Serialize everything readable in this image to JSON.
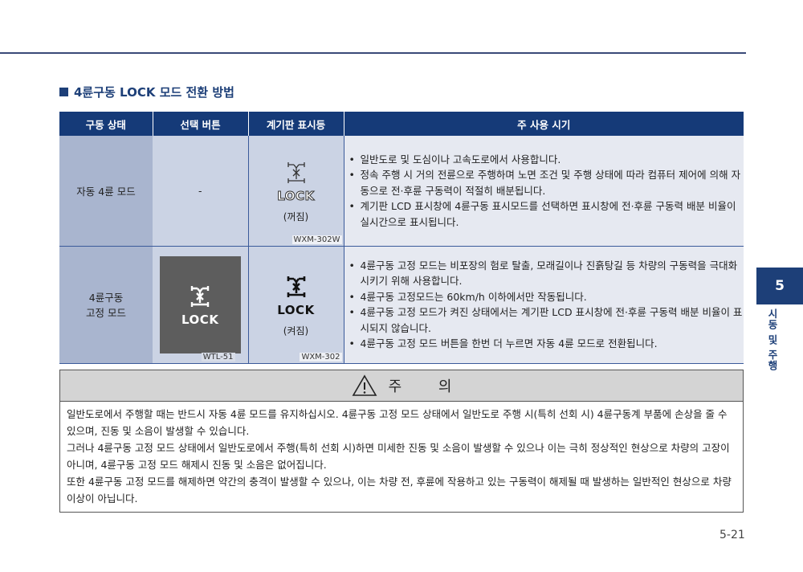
{
  "section": {
    "title": "4륜구동 LOCK 모드 전환 방법"
  },
  "table": {
    "headers": [
      "구동 상태",
      "선택 버튼",
      "계기판 표시등",
      "주 사용 시기"
    ],
    "rows": [
      {
        "state": "자동 4륜 모드",
        "button": "-",
        "indicator_label": "LOCK",
        "indicator_state": "(꺼짐)",
        "indicator_code": "WXM-302W",
        "uses": [
          "일반도로 및 도심이나 고속도로에서 사용합니다.",
          "정속 주행 시 거의 전륜으로 주행하며 노면 조건 및 주행 상태에 따라 컴퓨터 제어에 의해 자동으로 전·후륜 구동력이 적절히 배분됩니다.",
          "계기판 LCD 표시창에 4륜구동 표시모드를 선택하면 표시창에 전·후륜 구동력 배분 비율이 실시간으로 표시됩니다."
        ]
      },
      {
        "state_line1": "4륜구동",
        "state_line2": "고정 모드",
        "button_label": "LOCK",
        "button_code": "WTL-51",
        "indicator_label": "LOCK",
        "indicator_state": "(켜짐)",
        "indicator_code": "WXM-302",
        "uses": [
          "4륜구동 고정 모드는 비포장의 험로 탈출, 모래길이나 진흙탕길 등 차량의 구동력을 극대화 시키기 위해 사용합니다.",
          "4륜구동 고정모드는 60km/h 이하에서만 작동됩니다.",
          "4륜구동 고정 모드가 켜진 상태에서는 계기판 LCD 표시창에 전·후륜 구동력 배분 비율이 표시되지 않습니다.",
          "4륜구동 고정 모드 버튼을 한번 더 누르면 자동 4륜 모드로 전환됩니다."
        ]
      }
    ]
  },
  "caution": {
    "title": "주 의",
    "paragraphs": [
      "일반도로에서 주행할 때는 반드시 자동 4륜 모드를 유지하십시오. 4륜구동 고정 모드 상태에서 일반도로 주행 시(특히 선회 시) 4륜구동계 부품에 손상을 줄 수 있으며, 진동 및 소음이 발생할 수 있습니다.",
      "그러나 4륜구동 고정 모드 상태에서 일반도로에서 주행(특히 선회 시)하면 미세한 진동 및 소음이 발생할 수 있으나 이는 극히 정상적인 현상으로 차량의 고장이 아니며, 4륜구동 고정 모드 해제시 진동 및 소음은 없어집니다.",
      "또한 4륜구동 고정 모드를 해제하면 약간의 충격이 발생할 수 있으나, 이는 차량 전, 후륜에 작용하고 있는 구동력이 해제될 때 발생하는 일반적인 현상으로 차량 이상이 아닙니다."
    ]
  },
  "side": {
    "chapter": "5",
    "label": "시동 및 주행"
  },
  "page_number": "5-21",
  "colors": {
    "header_navy": "#153a78",
    "accent": "#1d3f78"
  }
}
